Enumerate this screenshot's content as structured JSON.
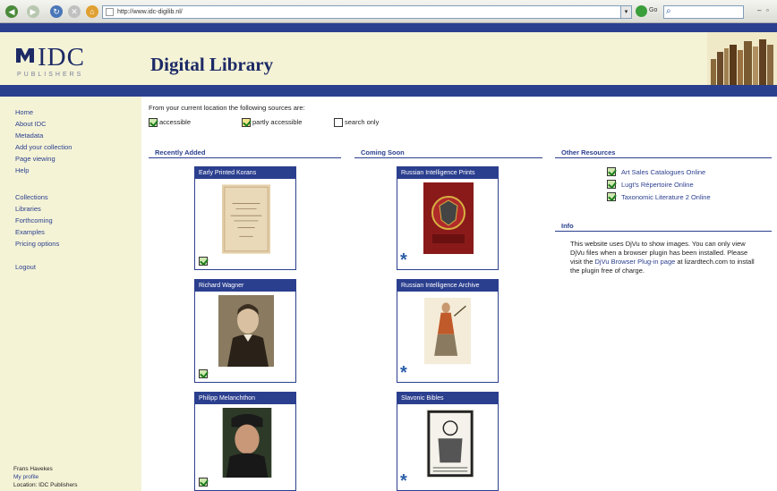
{
  "browser": {
    "url": "http://www.idc-digilib.nl/",
    "go_label": "Go"
  },
  "header": {
    "logo_text": "IDC",
    "logo_sub": "PUBLISHERS",
    "title": "Digital Library"
  },
  "sidebar": {
    "links": [
      "Home",
      "About IDC",
      "Metadata",
      "Add your collection",
      "Page viewing",
      "Help",
      "Collections",
      "Libraries",
      "Forthcoming",
      "Examples",
      "Pricing options",
      "Logout"
    ],
    "user": {
      "name": "Frans Havekes",
      "profile": "My profile",
      "location": "Location: IDC Publishers"
    }
  },
  "intro": "From your current location the following sources are:",
  "legend": {
    "accessible": "accessible",
    "partly": "partly accessible",
    "search_only": "search only"
  },
  "sections": {
    "recent": "Recently Added",
    "coming": "Coming Soon",
    "other": "Other Resources",
    "info": "Info"
  },
  "recent_cards": [
    {
      "title": "Early Printed Korans",
      "status": "accessible"
    },
    {
      "title": "Richard Wagner",
      "status": "accessible"
    },
    {
      "title": "Philipp Melanchthon",
      "status": "accessible"
    }
  ],
  "coming_cards": [
    {
      "title": "Russian Intelligence Prints",
      "status": "coming"
    },
    {
      "title": "Russian Intelligence Archive",
      "status": "coming"
    },
    {
      "title": "Slavonic Bibles",
      "status": "coming"
    }
  ],
  "other_resources": [
    "Art Sales Catalogues Online",
    "Lugt's Répertoire Online",
    "Taxonomic Literature 2 Online"
  ],
  "info": {
    "text_before": "This website uses DjVu to show images. You can only view DjVu files when a browser plugin has been installed. Please visit the ",
    "link": "DjVu Browser Plug-in page",
    "text_after": " at lizardtech.com to install the plugin free of charge."
  },
  "colors": {
    "brand_blue": "#2b3f8f",
    "cream": "#f4f3d6",
    "check_green": "#1d7d1d",
    "star_blue": "#2b5fa8"
  }
}
